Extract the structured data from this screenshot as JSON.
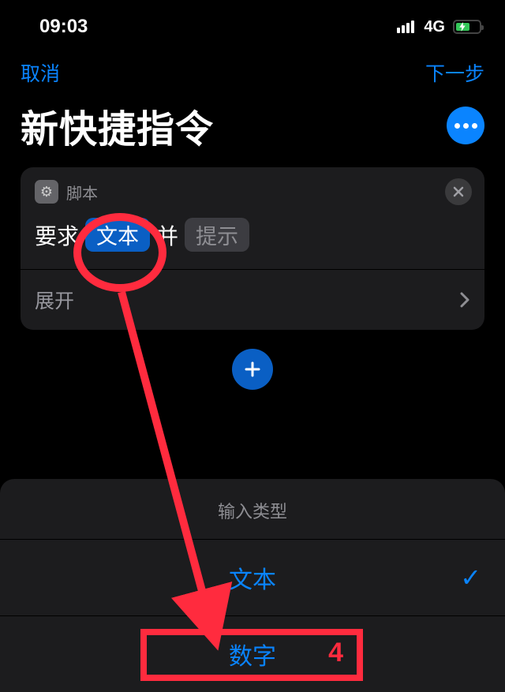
{
  "statusBar": {
    "time": "09:03",
    "network": "4G"
  },
  "nav": {
    "cancel": "取消",
    "next": "下一步"
  },
  "title": "新快捷指令",
  "actionCard": {
    "category": "脚本",
    "prefix": "要求",
    "typeToken": "文本",
    "middle": "并",
    "promptToken": "提示",
    "expand": "展开"
  },
  "picker": {
    "title": "输入类型",
    "option1": "文本",
    "option2": "数字"
  },
  "annotation": {
    "step": "4"
  }
}
